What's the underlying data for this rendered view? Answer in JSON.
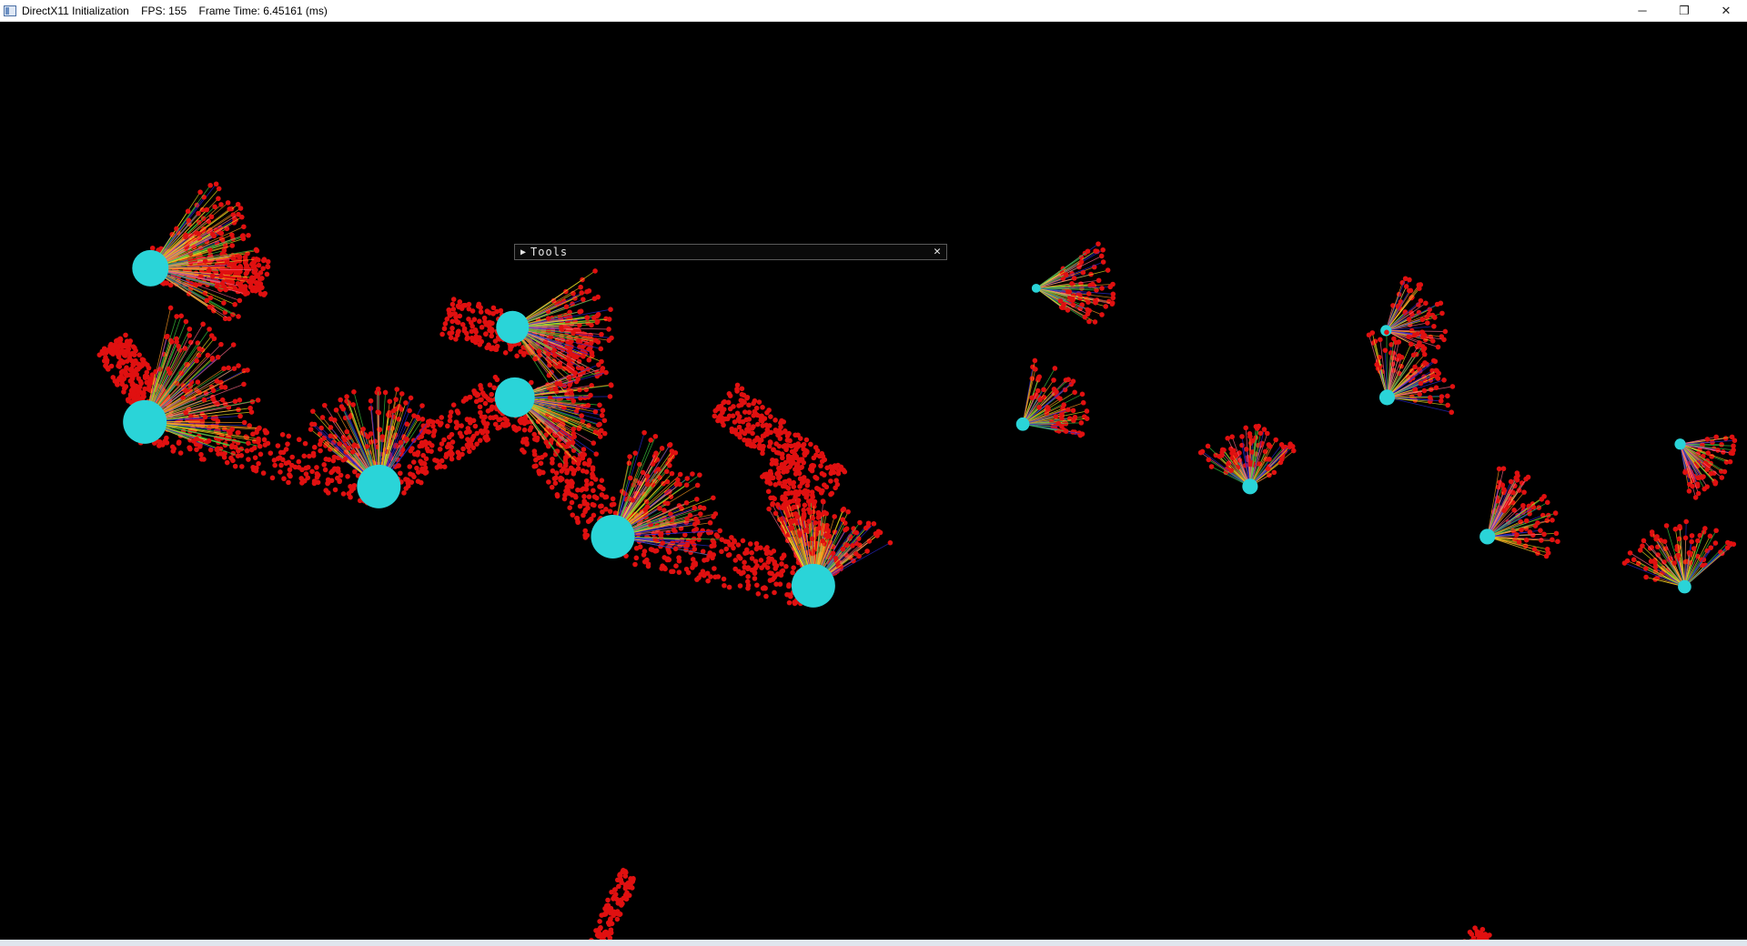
{
  "window": {
    "title": "DirectX11 Initialization    FPS: 155    Frame Time: 6.45161 (ms)",
    "controls": {
      "minimize_icon": "minimize-icon",
      "restore_icon": "restore-icon",
      "close_icon": "close-icon",
      "minimize_glyph": "─",
      "restore_glyph": "❐",
      "close_glyph": "✕"
    }
  },
  "tools_panel": {
    "title": "Tools",
    "collapse_glyph": "▶",
    "close_glyph": "✕"
  },
  "scene": {
    "background": "#000000",
    "joint_color": "#2ad4d8",
    "particle_color": "#e01010",
    "line_colors": [
      "#2b2bd8",
      "#ff6a8a",
      "#e8e020",
      "#3cd040",
      "#ff9a20"
    ]
  }
}
